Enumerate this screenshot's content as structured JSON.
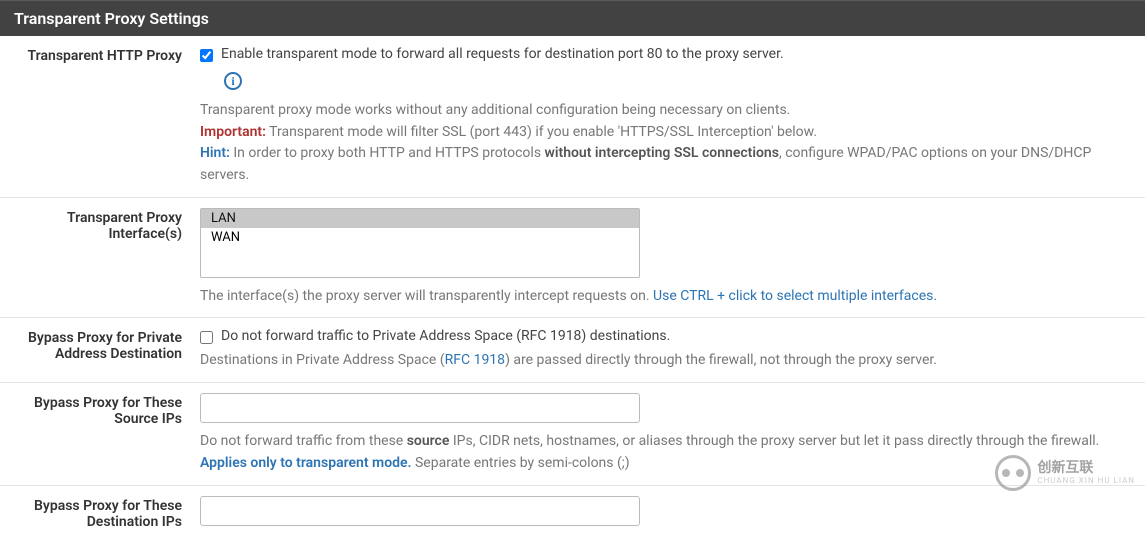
{
  "header": {
    "title": "Transparent Proxy Settings"
  },
  "rows": {
    "httpProxy": {
      "label": "Transparent HTTP Proxy",
      "checkbox_checked": true,
      "checkbox_label": "Enable transparent mode to forward all requests for destination port 80 to the proxy server.",
      "help_line1": "Transparent proxy mode works without any additional configuration being necessary on clients.",
      "important_label": "Important:",
      "important_text": " Transparent mode will filter SSL (port 443) if you enable 'HTTPS/SSL Interception' below.",
      "hint_label": "Hint:",
      "hint_pre": " In order to proxy both HTTP and HTTPS protocols ",
      "hint_bold": "without intercepting SSL connections",
      "hint_post": ", configure WPAD/PAC options on your DNS/DHCP servers."
    },
    "interfaces": {
      "label": "Transparent Proxy Interface(s)",
      "options": [
        {
          "value": "LAN",
          "selected": true
        },
        {
          "value": "WAN",
          "selected": false
        }
      ],
      "help_pre": "The interface(s) the proxy server will transparently intercept requests on. ",
      "help_link": "Use CTRL + click to select multiple interfaces."
    },
    "bypassPrivate": {
      "label": "Bypass Proxy for Private Address Destination",
      "checkbox_checked": false,
      "checkbox_label": "Do not forward traffic to Private Address Space (RFC 1918) destinations.",
      "help_pre": "Destinations in Private Address Space (",
      "help_link": "RFC 1918",
      "help_post": ") are passed directly through the firewall, not through the proxy server."
    },
    "bypassSourceIPs": {
      "label": "Bypass Proxy for These Source IPs",
      "value": "",
      "help_pre": "Do not forward traffic from these ",
      "help_bold": "source",
      "help_mid": " IPs, CIDR nets, hostnames, or aliases through the proxy server but let it pass directly through the firewall.",
      "applies_label": "Applies only to transparent mode.",
      "applies_post": " Separate entries by semi-colons (;)"
    },
    "bypassDestIPs": {
      "label": "Bypass Proxy for These Destination IPs",
      "value": ""
    }
  },
  "watermark": {
    "brand": "创新互联",
    "sub": "CHUANG XIN HU LIAN"
  }
}
